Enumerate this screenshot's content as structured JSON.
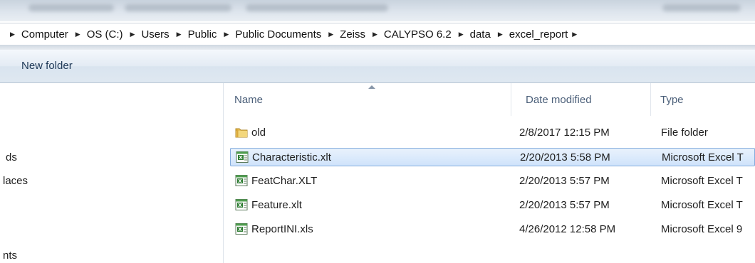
{
  "breadcrumb": [
    "Computer",
    "OS (C:)",
    "Users",
    "Public",
    "Public Documents",
    "Zeiss",
    "CALYPSO 6.2",
    "data",
    "excel_report"
  ],
  "toolbar": {
    "new_folder": "New folder"
  },
  "nav_items": [
    "ds",
    "laces",
    "nts"
  ],
  "columns": {
    "name": "Name",
    "date": "Date modified",
    "type": "Type"
  },
  "files": [
    {
      "name": "old",
      "date": "2/8/2017 12:15 PM",
      "type": "File folder",
      "icon": "folder-icon"
    },
    {
      "name": "Characteristic.xlt",
      "date": "2/20/2013 5:58 PM",
      "type": "Microsoft Excel T",
      "icon": "excel-file-icon",
      "selected": true
    },
    {
      "name": "FeatChar.XLT",
      "date": "2/20/2013 5:57 PM",
      "type": "Microsoft Excel T",
      "icon": "excel-file-icon"
    },
    {
      "name": "Feature.xlt",
      "date": "2/20/2013 5:57 PM",
      "type": "Microsoft Excel T",
      "icon": "excel-file-icon"
    },
    {
      "name": "ReportINI.xls",
      "date": "4/26/2012 12:58 PM",
      "type": "Microsoft Excel 9",
      "icon": "excel-file-icon"
    }
  ],
  "colors": {
    "selection_border": "#84acdd",
    "selection_fill": "#cfe3fb",
    "header_text": "#4c607a",
    "command_bar": "#dfe8f1"
  }
}
